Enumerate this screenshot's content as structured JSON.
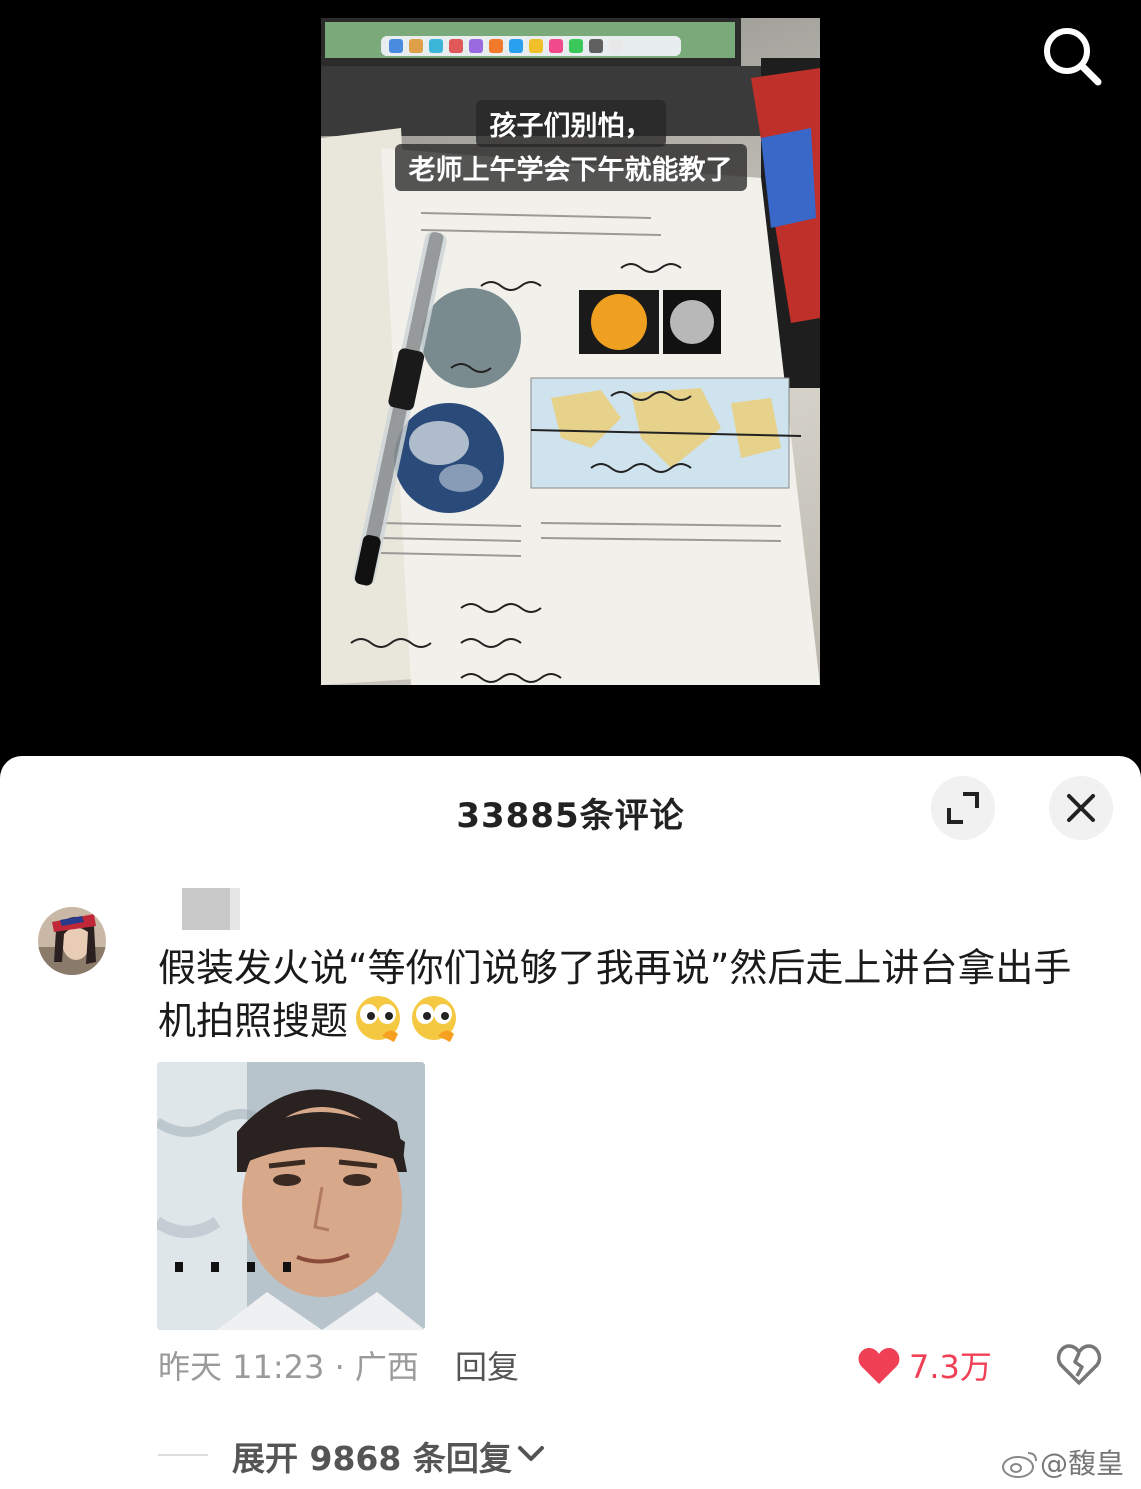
{
  "video": {
    "caption_line1": "孩子们别怕，",
    "caption_line2": "老师上午学会下午就能教了"
  },
  "comments_panel": {
    "title": "33885条评论"
  },
  "comment": {
    "text": "假装发火说“等你们说够了我再说”然后走上讲台拿出手机拍照搜题",
    "emojis": [
      "thinking-face-icon",
      "thinking-face-icon"
    ],
    "time_location": "昨天 11:23 · 广西",
    "reply_label": "回复",
    "like_count": "7.3万",
    "expand_replies_label": "展开 9868 条回复"
  },
  "watermark": "@馥皇",
  "colors": {
    "like_red": "#f04055",
    "sheet_bg": "#ffffff",
    "video_bg": "#000000"
  }
}
